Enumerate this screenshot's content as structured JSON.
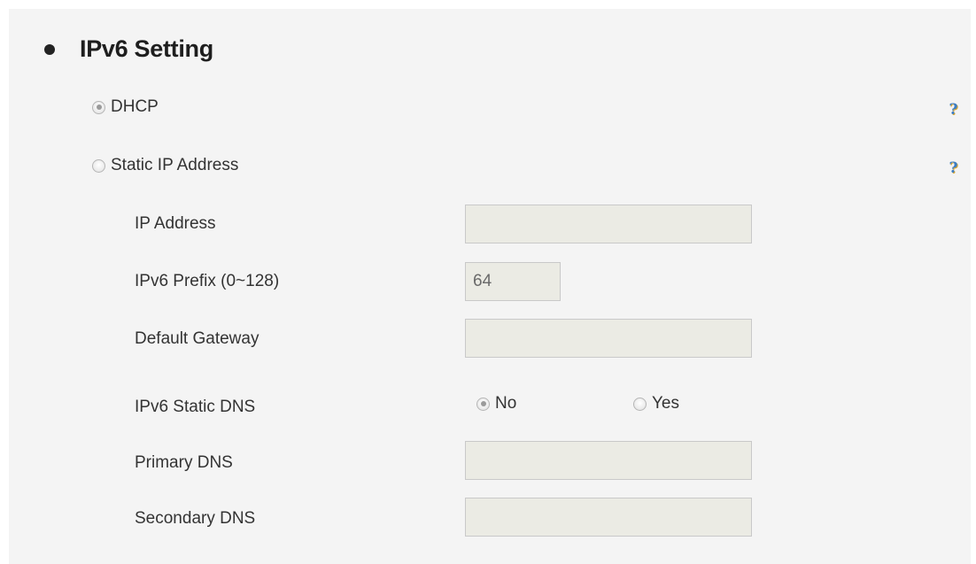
{
  "section": {
    "title": "IPv6 Setting"
  },
  "mode": {
    "dhcp_label": "DHCP",
    "static_label": "Static IP Address",
    "selected": "DHCP"
  },
  "help": {
    "glyph": "?"
  },
  "fields": {
    "ip_address": {
      "label": "IP Address",
      "value": ""
    },
    "prefix": {
      "label": "IPv6 Prefix (0~128)",
      "value": "64"
    },
    "gateway": {
      "label": "Default Gateway",
      "value": ""
    },
    "static_dns": {
      "label": "IPv6 Static DNS",
      "no_label": "No",
      "yes_label": "Yes",
      "selected": "No"
    },
    "primary_dns": {
      "label": "Primary DNS",
      "value": ""
    },
    "secondary_dns": {
      "label": "Secondary DNS",
      "value": ""
    }
  },
  "colors": {
    "panel_background": "#f4f4f4",
    "input_disabled_background": "#ebebe4",
    "help_icon": "#3b7dc4"
  }
}
